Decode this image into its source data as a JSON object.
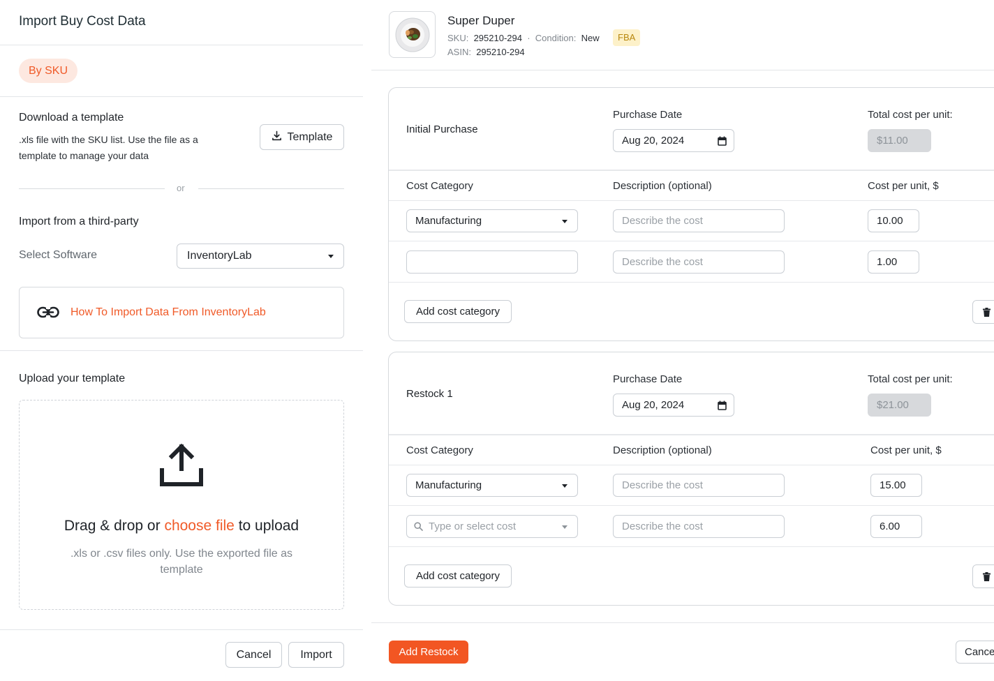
{
  "left": {
    "title": "Import Buy Cost Data",
    "tab_by_sku": "By SKU",
    "download": {
      "heading": "Download a template",
      "desc_line1": ".xls file with the SKU list. Use the file as a",
      "desc_line2": "template to manage your data",
      "button_label": "Template"
    },
    "or_label": "or",
    "third_party": {
      "heading": "Import from a third-party",
      "select_label": "Select Software",
      "select_value": "InventoryLab",
      "help_link": "How To Import Data From InventoryLab"
    },
    "upload": {
      "heading": "Upload your template",
      "drag_text_before": "Drag & drop or ",
      "drag_text_link": "choose file",
      "drag_text_after": " to upload",
      "hint_line1": ".xls or .csv files only. Use the exported file as",
      "hint_line2": "template"
    },
    "footer": {
      "cancel_label": "Cancel",
      "import_label": "Import"
    }
  },
  "right": {
    "product": {
      "name": "Super Duper",
      "sku_label": "SKU:",
      "sku_value": "295210-294",
      "separator": "·",
      "condition_label": "Condition:",
      "condition_value": "New",
      "badge": "FBA",
      "asin_label": "ASIN:",
      "asin_value": "295210-294"
    },
    "cards": [
      {
        "title": "Initial Purchase",
        "date_label": "Purchase Date",
        "date_value": "Aug 20, 2024",
        "total_label": "Total cost per unit:",
        "total_value": "$11.00",
        "col_category": "Cost Category",
        "col_description": "Description (optional)",
        "col_cost": "Cost per unit, $",
        "rows": [
          {
            "category": "Manufacturing",
            "description_placeholder": "Describe the cost",
            "cost": "10.00"
          },
          {
            "category": "",
            "description_placeholder": "Describe the cost",
            "cost": "1.00"
          }
        ],
        "add_label": "Add cost category"
      },
      {
        "title": "Restock 1",
        "date_label": "Purchase Date",
        "date_value": "Aug 20, 2024",
        "total_label": "Total cost per unit:",
        "total_value": "$21.00",
        "col_category": "Cost Category",
        "col_description": "Description (optional)",
        "col_cost": "Cost per unit, $",
        "rows": [
          {
            "category": "Manufacturing",
            "description_placeholder": "Describe the cost",
            "cost": "15.00"
          },
          {
            "category_placeholder": "Type or select cost",
            "description_placeholder": "Describe the cost",
            "cost": "6.00"
          }
        ],
        "add_label": "Add cost category"
      }
    ],
    "footer": {
      "add_restock_label": "Add Restock",
      "cancel_label": "Cance"
    }
  },
  "colors": {
    "accent": "#f25623",
    "accent_soft": "#fde8e0",
    "fba_bg": "#fdf1c9",
    "fba_text": "#b8870e",
    "disabled_bg": "#d7d9dc"
  },
  "icons": [
    "download-icon",
    "link-icon",
    "upload-icon",
    "calendar-icon",
    "chevron-down-icon",
    "search-icon",
    "trash-icon"
  ]
}
